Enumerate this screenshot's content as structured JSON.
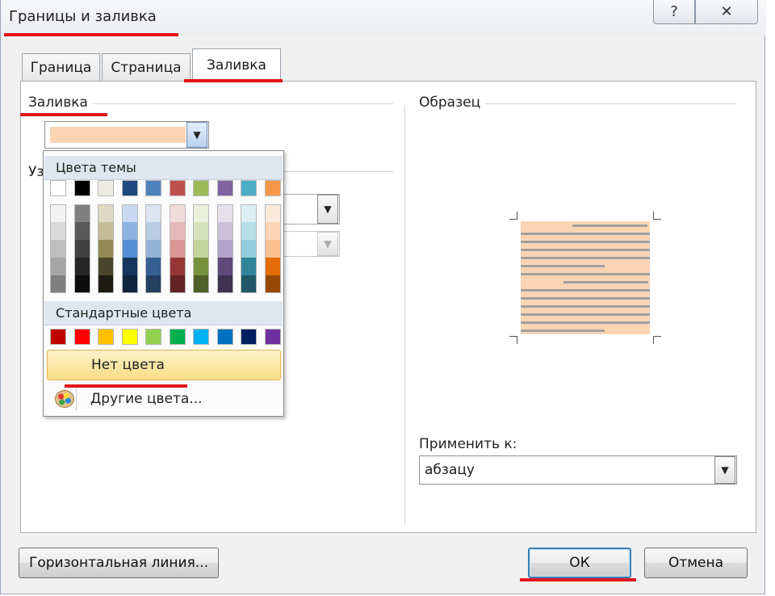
{
  "dialog": {
    "title": "Границы и заливка",
    "help_glyph": "?",
    "close_glyph": "✕"
  },
  "tabs": [
    {
      "label": "Граница",
      "active": false
    },
    {
      "label": "Страница",
      "active": false
    },
    {
      "label": "Заливка",
      "active": true
    }
  ],
  "fill": {
    "group_label": "Заливка",
    "selected_color": "#fbd4b4",
    "pattern_label_partial": "Уз"
  },
  "color_popup": {
    "theme_header": "Цвета темы",
    "theme_top_row": [
      "#ffffff",
      "#000000",
      "#eeece1",
      "#1f497d",
      "#4f81bd",
      "#c0504d",
      "#9bbb59",
      "#8064a2",
      "#4bacc6",
      "#f79646"
    ],
    "theme_columns": [
      [
        "#f2f2f2",
        "#d9d9d9",
        "#bfbfbf",
        "#a6a6a6",
        "#7f7f7f"
      ],
      [
        "#7f7f7f",
        "#595959",
        "#404040",
        "#262626",
        "#0d0d0d"
      ],
      [
        "#ddd9c3",
        "#c4bd97",
        "#948a54",
        "#4a452a",
        "#1e1c11"
      ],
      [
        "#c6d9f0",
        "#8db3e2",
        "#548dd4",
        "#17365d",
        "#0f243e"
      ],
      [
        "#dbe5f1",
        "#b8cce4",
        "#95b3d7",
        "#366092",
        "#244061"
      ],
      [
        "#f2dcdb",
        "#e5b9b7",
        "#d99694",
        "#953734",
        "#632423"
      ],
      [
        "#ebf1dd",
        "#d7e3bc",
        "#c3d69b",
        "#76923c",
        "#4f6128"
      ],
      [
        "#e5e0ec",
        "#ccc1d9",
        "#b2a2c7",
        "#5f497a",
        "#3f3151"
      ],
      [
        "#dbeef3",
        "#b7dde8",
        "#92cddc",
        "#31859b",
        "#205867"
      ],
      [
        "#fdeada",
        "#fbd5b5",
        "#fac08f",
        "#e36c09",
        "#974806"
      ]
    ],
    "standard_header": "Стандартные цвета",
    "standard_colors": [
      "#c00000",
      "#ff0000",
      "#ffc000",
      "#ffff00",
      "#92d050",
      "#00b050",
      "#00b0f0",
      "#0070c0",
      "#002060",
      "#7030a0"
    ],
    "no_color_label": "Нет цвета",
    "more_colors_label": "Другие цвета..."
  },
  "preview": {
    "group_label": "Образец",
    "fill_color": "#fbd4b4"
  },
  "apply": {
    "label": "Применить к:",
    "value": "абзацу"
  },
  "buttons": {
    "horizontal_line": "Горизонтальная линия...",
    "ok": "ОК",
    "cancel": "Отмена"
  },
  "annotation_color": "#e2141b"
}
